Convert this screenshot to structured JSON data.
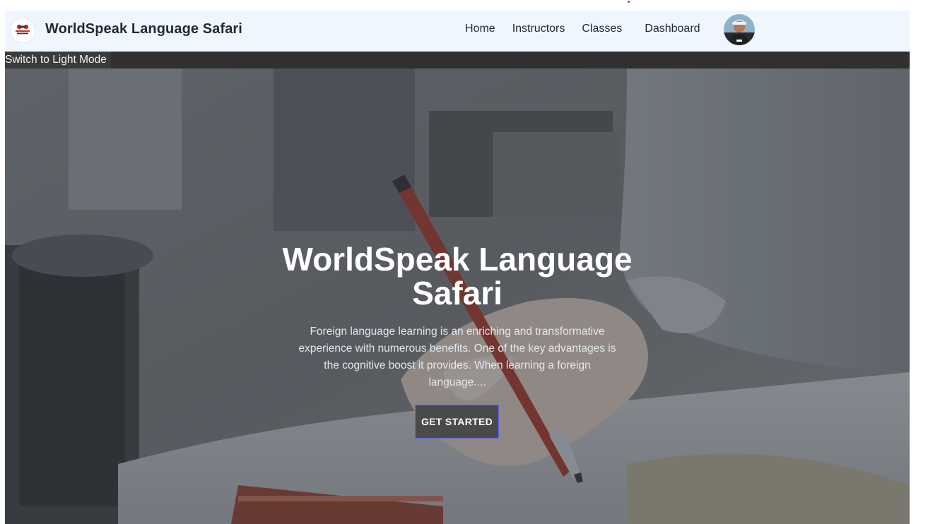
{
  "navbar": {
    "logo_icon": "language-game-logo",
    "brand_title": "WorldSpeak Language Safari",
    "links": {
      "home": "Home",
      "instructors": "Instructors",
      "classes": "Classes",
      "dashboard": "Dashboard"
    },
    "avatar_icon": "user-avatar"
  },
  "theme_toggle": {
    "label": "Switch to Light Mode"
  },
  "hero": {
    "title": "WorldSpeak Language Safari",
    "description": "Foreign language learning is an enriching and transformative experience with numerous benefits. One of the key advantages is the cognitive boost it provides. When learning a foreign language....",
    "cta_label": "GET STARTED",
    "background_icon": "hand-writing-with-pen-photo"
  },
  "colors": {
    "navbar_bg": "#eff6ff",
    "theme_bar_bg": "#303030",
    "cta_border": "#6366f1",
    "cta_bg": "#4a4a4a"
  }
}
